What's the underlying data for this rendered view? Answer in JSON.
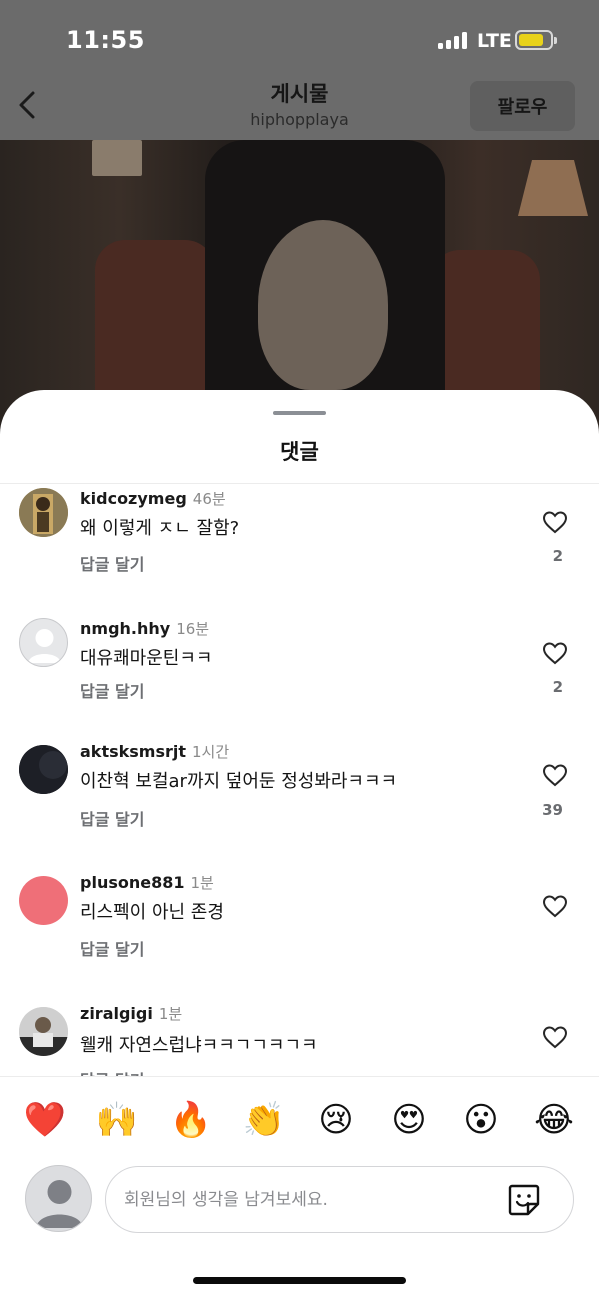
{
  "status_bar": {
    "time": "11:55",
    "network": "LTE",
    "battery_color": "#e8d21a"
  },
  "nav": {
    "title": "게시물",
    "subtitle": "hiphopplaya",
    "follow_label": "팔로우"
  },
  "sheet": {
    "title": "댓글"
  },
  "comments": [
    {
      "user": "kidcozymeg",
      "time": "46분",
      "text": "왜 이렇게 ㅈㄴ 잘함?",
      "reply_label": "답글 달기",
      "likes": "2",
      "avatar": "photo-avatar"
    },
    {
      "user": "nmgh.hhy",
      "time": "16분",
      "text": "대유쾌마운틴ㅋㅋ",
      "reply_label": "답글 달기",
      "likes": "2",
      "avatar": "default-avatar"
    },
    {
      "user": "aktsksmsrjt",
      "time": "1시간",
      "text": "이찬혁 보컬ar까지 덮어둔 정성봐라ㅋㅋㅋ",
      "reply_label": "답글 달기",
      "likes": "39",
      "avatar": "dark-avatar"
    },
    {
      "user": "plusone881",
      "time": "1분",
      "text": "리스펙이 아닌 존경",
      "reply_label": "답글 달기",
      "likes": "",
      "avatar": "pink-avatar"
    },
    {
      "user": "ziralgigi",
      "time": "1분",
      "text": "웰캐 자연스럽냐ㅋㅋㄱㄱㅋㄱㅋ",
      "reply_label": "답글 달기",
      "likes": "",
      "avatar": "photo-avatar"
    }
  ],
  "emoji_reactions": [
    "❤️",
    "🙌",
    "🔥",
    "👏",
    "😢",
    "😍",
    "😮",
    "😂"
  ],
  "composer": {
    "placeholder": "회원님의 생각을 남겨보세요."
  },
  "colors": {
    "heart_outline": "#262626",
    "pink_avatar": "#ef6f78"
  }
}
